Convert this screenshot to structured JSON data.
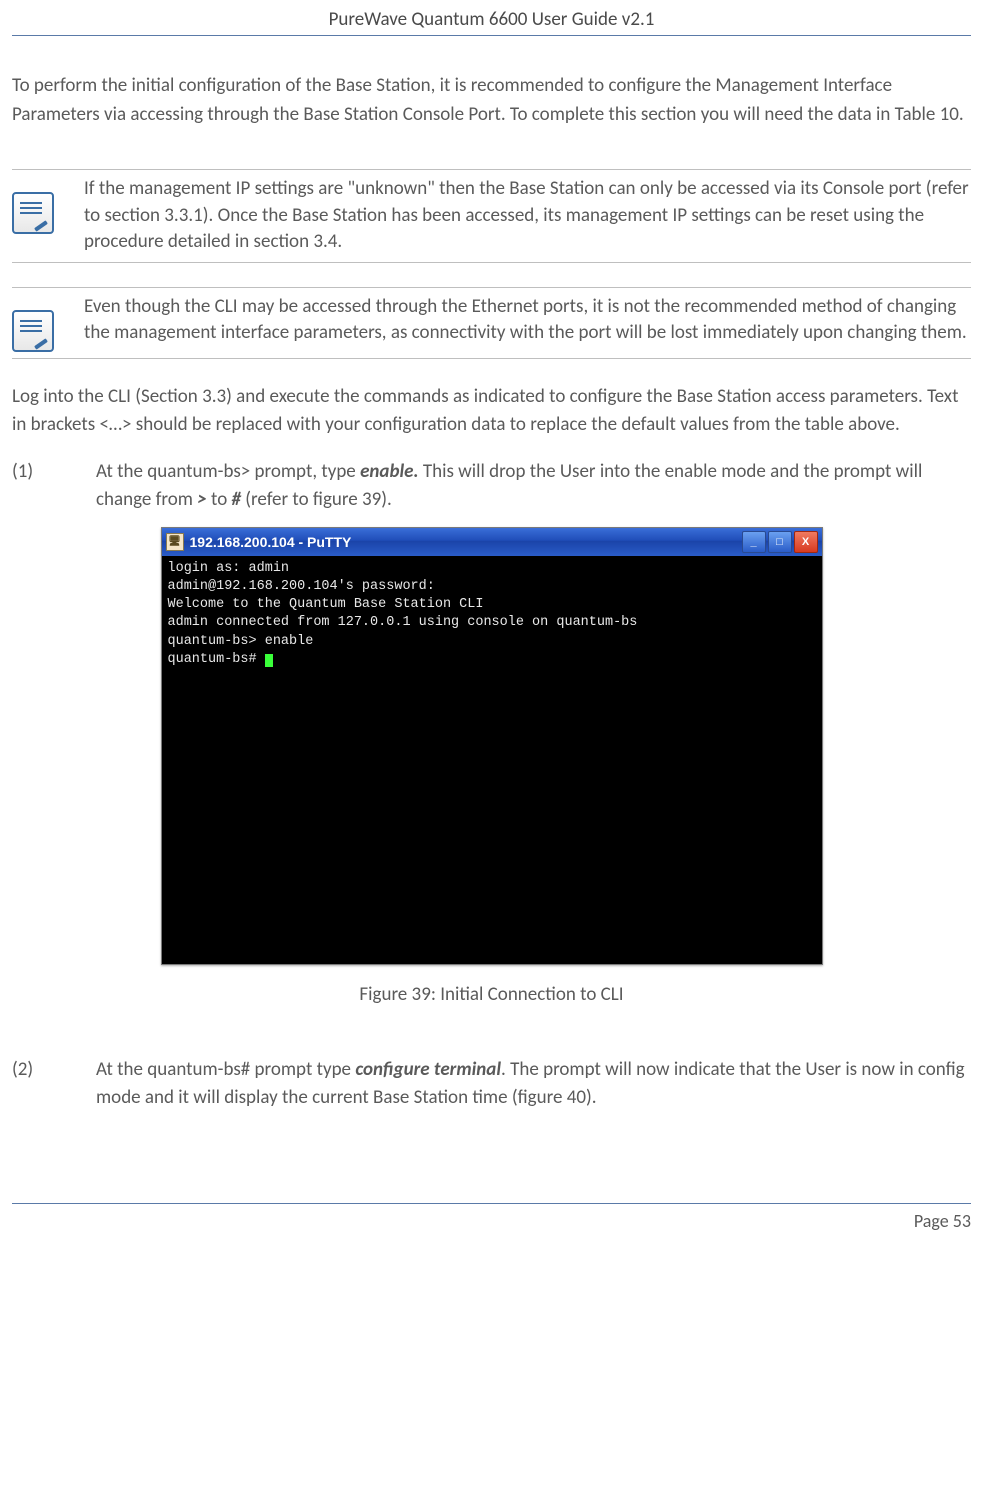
{
  "header": {
    "title": "PureWave Quantum 6600 User Guide v2.1"
  },
  "intro": "To perform the initial configuration of the Base Station, it is recommended to configure the Management Interface Parameters via accessing through the Base Station Console Port. To complete this section you will need the data in Table 10.",
  "note1": "If the management IP settings are \"unknown\" then the Base Station can only be accessed via its Console port (refer to section 3.3.1). Once the Base Station has been accessed, its management IP settings can be reset using the procedure detailed in section 3.4.",
  "note2": "Even though the CLI may be accessed through the Ethernet ports, it is not the recommended method of changing the management interface parameters, as connectivity with the port will be lost immediately upon changing them.",
  "para2": "Log into the CLI (Section 3.3) and execute the commands as indicated to configure the Base Station access parameters. Text in brackets <…> should be replaced with your configuration data to replace the default values from the table above.",
  "step1": {
    "num": "(1)",
    "pre": "At the quantum-bs> prompt, type ",
    "cmd": "enable.",
    "mid": "  This will drop the User into the enable mode and the prompt will change from ",
    "sym1": ">",
    "to": " to ",
    "sym2": "#",
    "post": " (refer to figure 39)."
  },
  "putty": {
    "title": "192.168.200.104 - PuTTY",
    "min": "_",
    "max": "□",
    "close": "X",
    "lines": [
      "login as: admin",
      "admin@192.168.200.104's password:",
      "Welcome to the Quantum Base Station CLI",
      "admin connected from 127.0.0.1 using console on quantum-bs",
      "quantum-bs> enable",
      "quantum-bs# "
    ]
  },
  "figcaption": "Figure 39: Initial Connection to CLI",
  "step2": {
    "num": "(2)",
    "pre": "At the quantum-bs# prompt type ",
    "cmd": "configure terminal",
    "post": ". The prompt will now indicate that the User is now in config mode and it will display the current Base Station time (figure 40)."
  },
  "footer": {
    "page": "Page 53"
  }
}
